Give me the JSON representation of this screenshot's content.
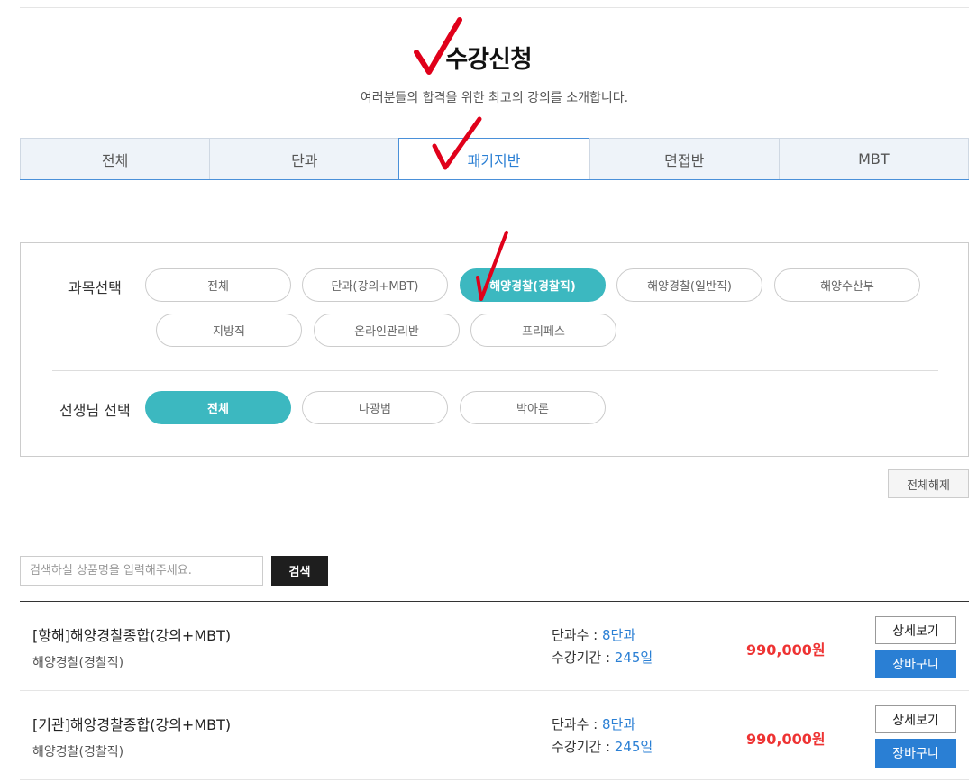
{
  "header": {
    "title": "수강신청",
    "subtitle": "여러분들의 합격을 위한 최고의 강의를 소개합니다."
  },
  "tabs": [
    {
      "label": "전체",
      "active": false
    },
    {
      "label": "단과",
      "active": false
    },
    {
      "label": "패키지반",
      "active": true
    },
    {
      "label": "면접반",
      "active": false
    },
    {
      "label": "MBT",
      "active": false
    }
  ],
  "filters": {
    "subject_label": "과목선택",
    "subjects": [
      {
        "label": "전체",
        "active": false
      },
      {
        "label": "단과(강의+MBT)",
        "active": false
      },
      {
        "label": "해양경찰(경찰직)",
        "active": true
      },
      {
        "label": "해양경찰(일반직)",
        "active": false
      },
      {
        "label": "해양수산부",
        "active": false
      },
      {
        "label": "지방직",
        "active": false
      },
      {
        "label": "온라인관리반",
        "active": false
      },
      {
        "label": "프리페스",
        "active": false
      }
    ],
    "teacher_label": "선생님 선택",
    "teachers": [
      {
        "label": "전체",
        "active": true
      },
      {
        "label": "나광범",
        "active": false
      },
      {
        "label": "박아론",
        "active": false
      }
    ],
    "reset_label": "전체해제"
  },
  "search": {
    "placeholder": "검색하실 상품명을 입력해주세요.",
    "button_label": "검색"
  },
  "products": [
    {
      "title": "[항해]해양경찰종합(강의+MBT)",
      "category": "해양경찰(경찰직)",
      "count_label": "단과수 : ",
      "count_value": "8단과",
      "period_label": "수강기간 : ",
      "period_value": "245일",
      "price": "990,000원",
      "detail_label": "상세보기",
      "cart_label": "장바구니"
    },
    {
      "title": "[기관]해양경찰종합(강의+MBT)",
      "category": "해양경찰(경찰직)",
      "count_label": "단과수 : ",
      "count_value": "8단과",
      "period_label": "수강기간 : ",
      "period_value": "245일",
      "price": "990,000원",
      "detail_label": "상세보기",
      "cart_label": "장바구니"
    }
  ],
  "colors": {
    "accent": "#3cb8c0",
    "link": "#2a7fd4",
    "price": "#ee3333",
    "check": "#e0001a"
  }
}
